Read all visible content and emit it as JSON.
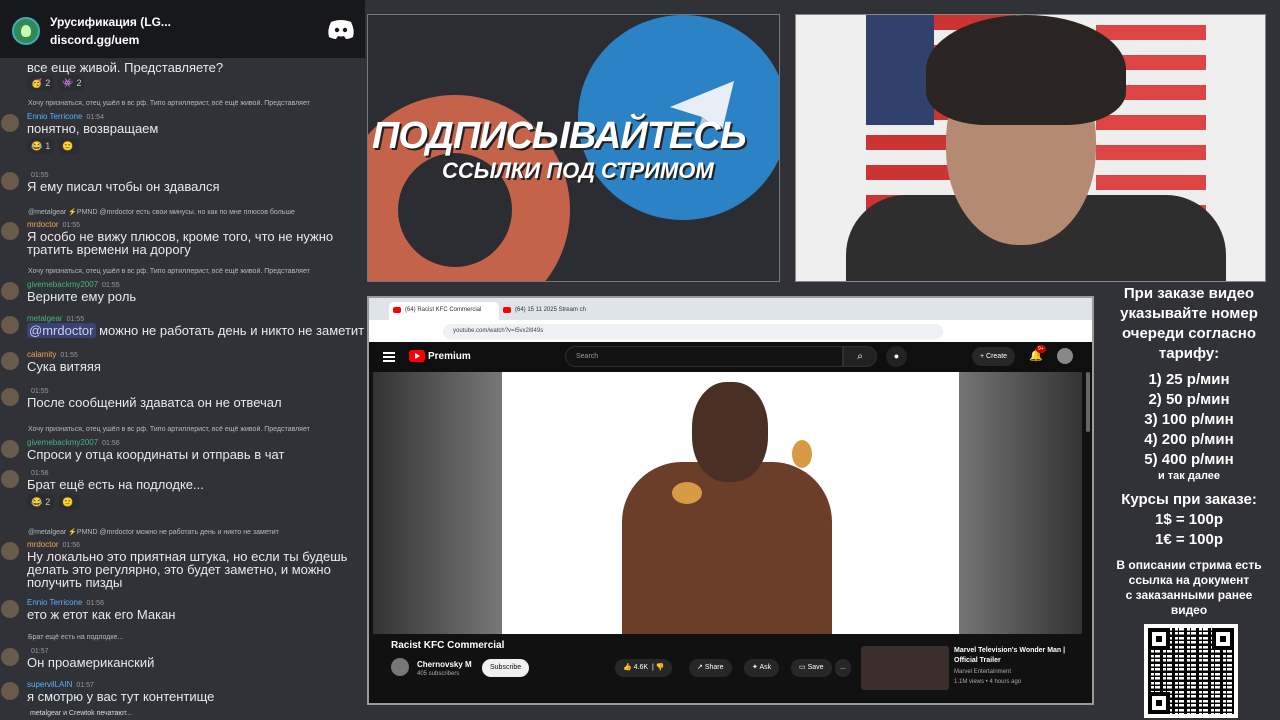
{
  "discord": {
    "server_name": "Урусификация (LG...",
    "invite": "discord.gg/uem"
  },
  "chat": {
    "top_fragment": "все еще живой. Представляете?",
    "top_reactions": [
      "2",
      "2"
    ],
    "messages": [
      {
        "reply": "Хочу признаться, отец ушёл в вс рф. Типо артиллерист, всё ещё живой. Представляет",
        "user": "Ennio Terricone",
        "user_color": "#5ab0ff",
        "time": "01:54",
        "text": "понятно, возвращаем",
        "reactions": [
          "1",
          ""
        ]
      },
      {
        "reply": "",
        "user": "",
        "user_color": "#949ba4",
        "time": "01:55",
        "text": "Я ему писал чтобы он здавался",
        "reactions": []
      },
      {
        "reply": "@metalgear ⚡PMND @mrdoctor есть свои минусы. но как по мне плюсов больше",
        "user": "mrdoctor",
        "user_color": "#f0a35c",
        "time": "01:55",
        "text": "Я особо не вижу плюсов, кроме того, что не нужно тратить времени на дорогу",
        "reactions": []
      },
      {
        "reply": "Хочу признаться, отец ушёл в вс рф. Типо артиллерист, всё ещё живой. Представляет",
        "user": "givemebackmy2007",
        "user_color": "#43b581",
        "time": "01:55",
        "text": "Верните ему роль",
        "reactions": []
      },
      {
        "reply": "",
        "user": "metalgear",
        "user_color": "#43b581",
        "time": "01:55",
        "text": "@mrdoctor можно не работать день и никто не заметит",
        "reactions": []
      },
      {
        "reply": "",
        "user": "calamity",
        "user_color": "#f0a35c",
        "time": "01:55",
        "text": "Сука витяяя",
        "reactions": []
      },
      {
        "reply": "",
        "user": "",
        "user_color": "#949ba4",
        "time": "01:55",
        "text": "После сообщений здаватса он не отвечал",
        "reactions": []
      },
      {
        "reply": "Хочу признаться, отец ушёл в вс рф. Типо артиллерист, всё ещё живой. Представляет",
        "user": "givemebackmy2007",
        "user_color": "#43b581",
        "time": "01:56",
        "text": "Спроси у отца координаты и отправь в чат",
        "reactions": []
      },
      {
        "reply": "",
        "user": "",
        "user_color": "#949ba4",
        "time": "01:56",
        "text": "Брат ещё есть на подлодке...",
        "reactions": [
          "2",
          ""
        ]
      },
      {
        "reply": "@metalgear ⚡PMND @mrdoctor можно не работать день и никто не заметит",
        "user": "mrdoctor",
        "user_color": "#f0a35c",
        "time": "01:56",
        "text": "Ну локально это приятная штука, но если ты будешь делать это регулярно, это будет заметно, и можно получить пизды",
        "reactions": []
      },
      {
        "reply": "",
        "user": "Ennio Terricone",
        "user_color": "#5ab0ff",
        "time": "01:56",
        "text": "ето ж етот как его Макан",
        "reactions": []
      },
      {
        "reply": "Брат ещё есть на подлодке...",
        "user": "",
        "user_color": "#949ba4",
        "time": "01:57",
        "text": "Он проамериканский",
        "reactions": []
      },
      {
        "reply": "",
        "user": "supervilLAIN",
        "user_color": "#5ab0ff",
        "time": "01:57",
        "text": "я смотрю у вас тут контентище",
        "reactions": []
      }
    ],
    "typing": "metalgear и Crewtok печатают..."
  },
  "promo": {
    "title": "ПОДПИСЫВАЙТЕСЬ",
    "subtitle": "ССЫЛКИ ПОД СТРИМОМ"
  },
  "browser": {
    "tab1": "(64) Racist KFC Commercial",
    "tab2": "(64) 15 11 2025 Stream ch",
    "url": "youtube.com/watch?v=I5vx2itI49s"
  },
  "youtube": {
    "brand": "Premium",
    "search_placeholder": "Search",
    "create": "+ Create",
    "notif_count": "9+",
    "video_title": "Racist KFC Commercial",
    "channel": "Chernovsky M",
    "subscribers": "405 subscribers",
    "subscribe": "Subscribe",
    "likes": "4.6K",
    "share": "Share",
    "ask": "Ask",
    "save": "Save",
    "more": "...",
    "rec": {
      "title": "Marvel Television's Wonder Man | Official Trailer",
      "channel": "Marvel Entertainment",
      "meta": "1.1M views • 4 hours ago",
      "duration": "2:10"
    }
  },
  "info": {
    "lines": [
      "При заказе видео",
      "указывайте номер",
      "очереди согласно",
      "тарифу:"
    ],
    "tariffs": [
      "1) 25 р/мин",
      "2) 50 р/мин",
      "3) 100 р/мин",
      "4) 200 р/мин",
      "5) 400 р/мин"
    ],
    "etc": "и так далее",
    "rates_title": "Курсы при заказе:",
    "rates": [
      "1$ = 100р",
      "1€ = 100р"
    ],
    "desc": [
      "В описании стрима есть",
      "ссылка на документ",
      "с заказанными ранее",
      "видео"
    ]
  }
}
